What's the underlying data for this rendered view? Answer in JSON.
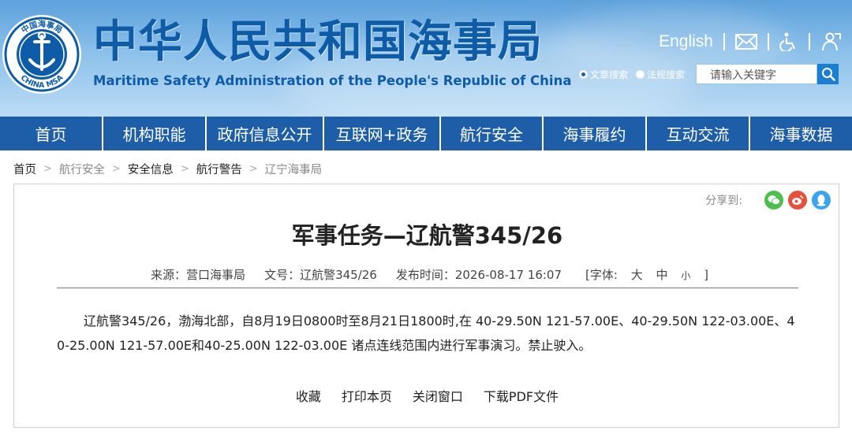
{
  "header": {
    "logo_top_text": "中国海事局",
    "logo_bottom_text": "CHINA MSA",
    "title_cn": "中华人民共和国海事局",
    "title_en": "Maritime Safety Administration of the People's Republic of China",
    "english_link": "English",
    "search": {
      "option_article": "文章搜索",
      "option_regulation": "法规搜索",
      "placeholder": "请输入关键字"
    }
  },
  "nav": {
    "items": [
      "首页",
      "机构职能",
      "政府信息公开",
      "互联网+政务",
      "航行安全",
      "海事履约",
      "互动交流",
      "海事数据"
    ]
  },
  "breadcrumb": [
    "首页",
    "航行安全",
    "安全信息",
    "航行警告",
    "辽宁海事局"
  ],
  "article": {
    "share_label": "分享到:",
    "title": "军事任务—辽航警345/26",
    "meta": {
      "source": "来源：营口海事局",
      "doc_no": "文号：辽航警345/26",
      "publish_time": "发布时间：2026-08-17 16:07",
      "font_label": "[字体:",
      "font_large": "大",
      "font_medium": "中",
      "font_small": "小",
      "font_close": "]"
    },
    "body": "辽航警345/26，渤海北部，自8月19日0800时至8月21日1800时,在 40-29.50N 121-57.00E、40-29.50N 122-03.00E、40-25.00N 121-57.00E和40-25.00N 122-03.00E 诸点连线范围内进行军事演习。禁止驶入。",
    "actions": [
      "收藏",
      "打印本页",
      "关闭窗口",
      "下载PDF文件"
    ]
  },
  "colors": {
    "nav_bg": "#1e5ea8",
    "title_blue": "#0e5ca8",
    "wechat": "#4cbf4c",
    "weibo": "#e6503c",
    "qq": "#3aa4f0"
  }
}
